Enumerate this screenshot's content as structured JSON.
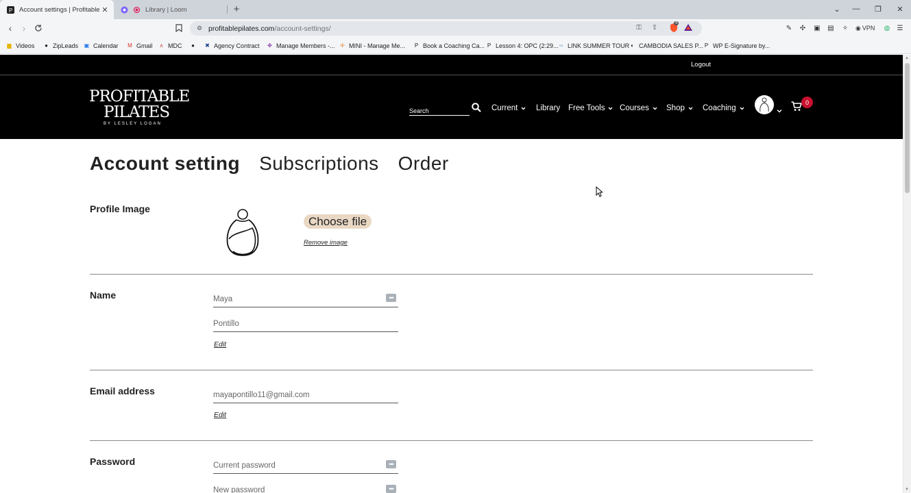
{
  "browser": {
    "tabs": [
      {
        "title": "Account settings | Profitable Pi",
        "active": true
      },
      {
        "title": "Library | Loom",
        "active": false
      }
    ],
    "url_host": "profitablepilates.com",
    "url_path": "/account-settings/",
    "vpn_label": "VPN",
    "shield_count": "4",
    "bookmarks": [
      {
        "label": "Videos",
        "icon": "folder-icon"
      },
      {
        "label": "ZipLeads",
        "icon": "zipleads-icon"
      },
      {
        "label": "Calendar",
        "icon": "calendar-icon"
      },
      {
        "label": "Gmail",
        "icon": "gmail-icon"
      },
      {
        "label": "MDC",
        "icon": "mdc-icon"
      },
      {
        "label": "",
        "icon": "circle-icon"
      },
      {
        "label": "Agency Contract",
        "icon": "agency-icon"
      },
      {
        "label": "Manage Members -...",
        "icon": "members-icon"
      },
      {
        "label": "MINI - Manage Me...",
        "icon": "mini-icon"
      },
      {
        "label": "Book a Coaching Ca...",
        "icon": "pilates-icon"
      },
      {
        "label": "Lesson 4: OPC (2:29...",
        "icon": "pilates-icon"
      },
      {
        "label": "LINK SUMMER TOUR",
        "icon": "link-icon"
      },
      {
        "label": "CAMBODIA SALES P...",
        "icon": "cambodia-icon"
      },
      {
        "label": "WP E-Signature by...",
        "icon": "pilates-icon"
      }
    ]
  },
  "site": {
    "logout": "Logout",
    "logo": {
      "line1": "PROFITABLE",
      "line2": "PILATES",
      "line3": "BY LESLEY LOGAN"
    },
    "search_placeholder": "Search",
    "nav": [
      {
        "label": "Current",
        "dropdown": true
      },
      {
        "label": "Library",
        "dropdown": false
      },
      {
        "label": "Free Tools",
        "dropdown": true
      },
      {
        "label": "Courses",
        "dropdown": true
      },
      {
        "label": "Shop",
        "dropdown": true
      },
      {
        "label": "Coaching",
        "dropdown": true
      }
    ],
    "cart_count": "0"
  },
  "account": {
    "tabs": [
      "Account setting",
      "Subscriptions",
      "Order"
    ],
    "profile": {
      "label": "Profile Image",
      "choose_file": "Choose file",
      "remove_image": "Remove image"
    },
    "name": {
      "label": "Name",
      "first_placeholder": "Maya",
      "last_placeholder": "Pontillo",
      "edit": "Edit"
    },
    "email": {
      "label": "Email address",
      "placeholder": "mayapontillo11@gmail.com",
      "edit": "Edit"
    },
    "password": {
      "label": "Password",
      "current_placeholder": "Current password",
      "new_placeholder": "New password"
    }
  },
  "colors": {
    "header_bg": "#000000",
    "accent_button": "#e9d8c4",
    "badge": "#c8102e"
  }
}
